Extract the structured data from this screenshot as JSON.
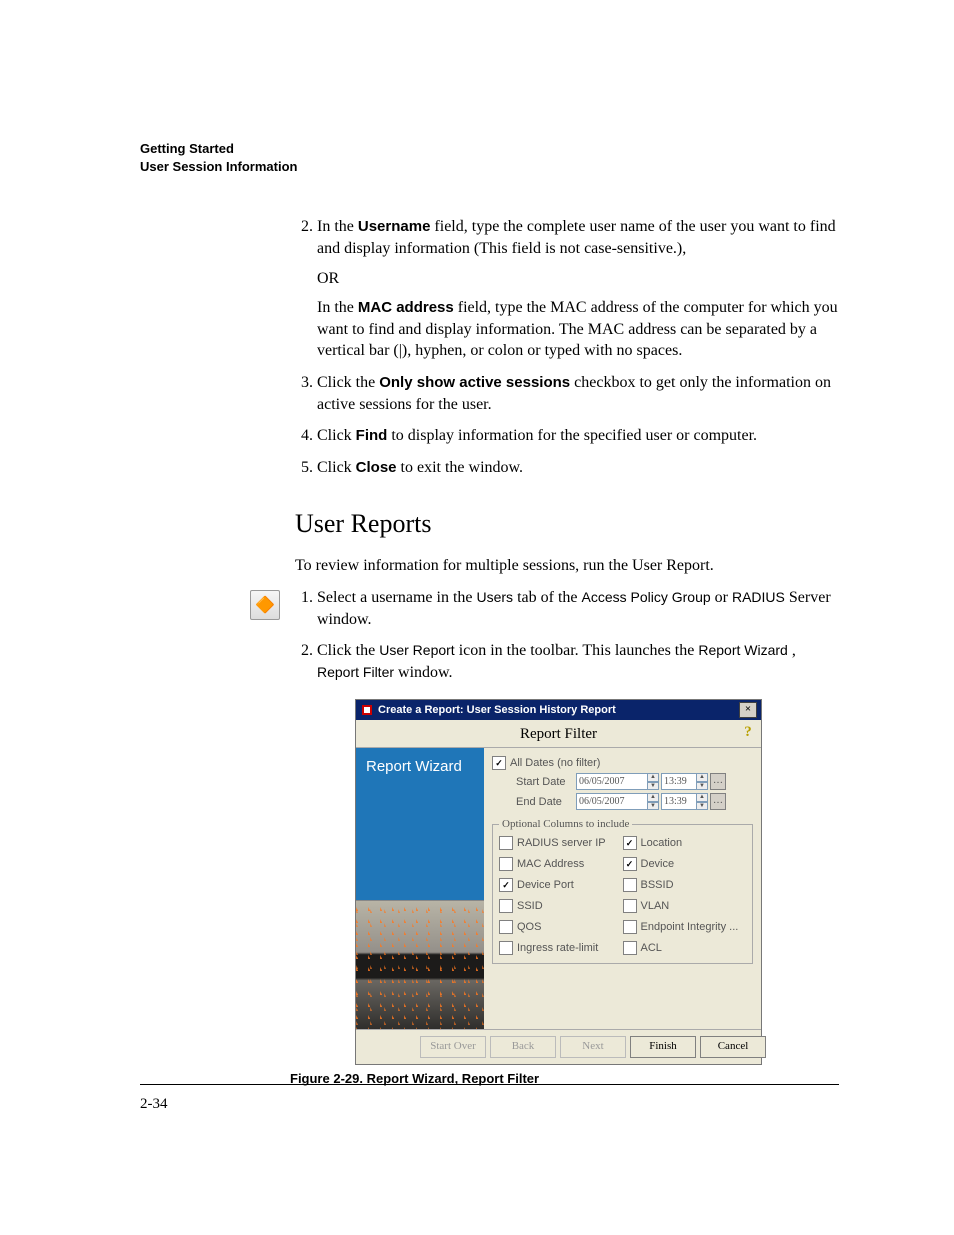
{
  "header": {
    "line1": "Getting Started",
    "line2": "User Session Information"
  },
  "steps": {
    "s2a_pre": "In the ",
    "s2a_bold": "Username",
    "s2a_post": " field, type the complete user name of the user you want to find and display information (This field is not case-sensitive.),",
    "s2_or": "OR",
    "s2b_pre": "In the ",
    "s2b_bold": "MAC address",
    "s2b_post": " field, type the MAC address of the computer for which you want to find and display information. The MAC address can be separated by a vertical bar (|), hyphen, or colon or typed with no spaces.",
    "s3_pre": "Click the ",
    "s3_bold": "Only show active sessions",
    "s3_post": " checkbox to get only the information on active sessions for the user.",
    "s4_pre": "Click ",
    "s4_bold": "Find",
    "s4_post": " to display information for the specified user or computer.",
    "s5_pre": "Click ",
    "s5_bold": "Close",
    "s5_post": " to exit the window."
  },
  "section_heading": "User Reports",
  "intro": "To review information for multiple sessions, run the User Report.",
  "steps_b": {
    "s1_a": "Select a username in the ",
    "s1_users": "Users",
    "s1_b": " tab of the ",
    "s1_apg": "Access Policy Group",
    "s1_c": " or ",
    "s1_radius": "RADIUS",
    "s1_d": " Server window.",
    "s2_a": "Click the ",
    "s2_ur": "User Report",
    "s2_b": " icon in the toolbar. This launches the ",
    "s2_rw": "Report Wizard",
    "s2_c": ", ",
    "s2_rf": "Report Filter",
    "s2_d": " window."
  },
  "dialog": {
    "title": "Create a Report: User Session History Report",
    "close": "×",
    "head": "Report Filter",
    "help": "?",
    "left_title": "Report Wizard",
    "all_dates": "All Dates (no filter)",
    "start_label": "Start Date",
    "end_label": "End Date",
    "start_date": "06/05/2007",
    "start_time": "13:39",
    "end_date": "06/05/2007",
    "end_time": "13:39",
    "ellipsis": "…",
    "cols_legend": "Optional Columns to include",
    "col_radius": "RADIUS server IP",
    "col_location": "Location",
    "col_mac": "MAC Address",
    "col_device": "Device",
    "col_devport": "Device Port",
    "col_bssid": "BSSID",
    "col_ssid": "SSID",
    "col_vlan": "VLAN",
    "col_qos": "QOS",
    "col_eint": "Endpoint Integrity ...",
    "col_ingress": "Ingress rate-limit",
    "col_acl": "ACL",
    "btn_startover": "Start Over",
    "btn_back": "Back",
    "btn_next": "Next",
    "btn_finish": "Finish",
    "btn_cancel": "Cancel"
  },
  "figure_caption": "Figure 2-29. Report Wizard, Report Filter",
  "page_number": "2-34"
}
